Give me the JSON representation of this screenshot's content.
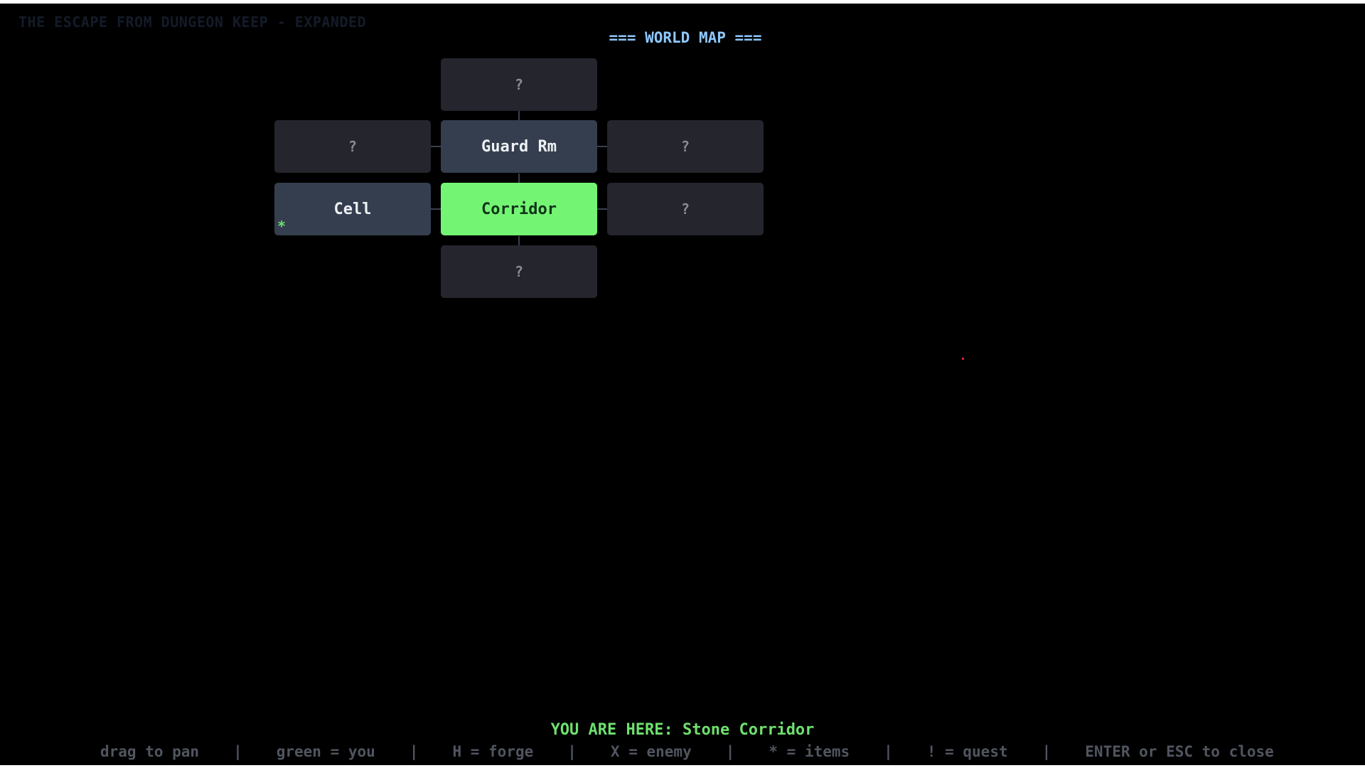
{
  "game_title": "THE ESCAPE FROM DUNGEON KEEP - EXPANDED",
  "map_title": "=== WORLD MAP ===",
  "rooms": {
    "north": "?",
    "guard_room": "Guard Rm",
    "northwest": "?",
    "northeast": "?",
    "cell": "Cell",
    "corridor": "Corridor",
    "east": "?",
    "south": "?"
  },
  "cell_marker": "*",
  "you_are_here": "YOU ARE HERE: Stone Corridor",
  "legend": {
    "pan": "drag to pan",
    "you": "green = you",
    "forge": "H = forge",
    "enemy": "X = enemy",
    "items": "* = items",
    "quest": "! = quest",
    "close": "ENTER or ESC to close",
    "separator": "|"
  },
  "colors": {
    "current_room": "#73f573",
    "visited_room": "#353e4e",
    "unknown_room": "#24252d",
    "title": "#8ec8ff",
    "status": "#6ee06e"
  }
}
